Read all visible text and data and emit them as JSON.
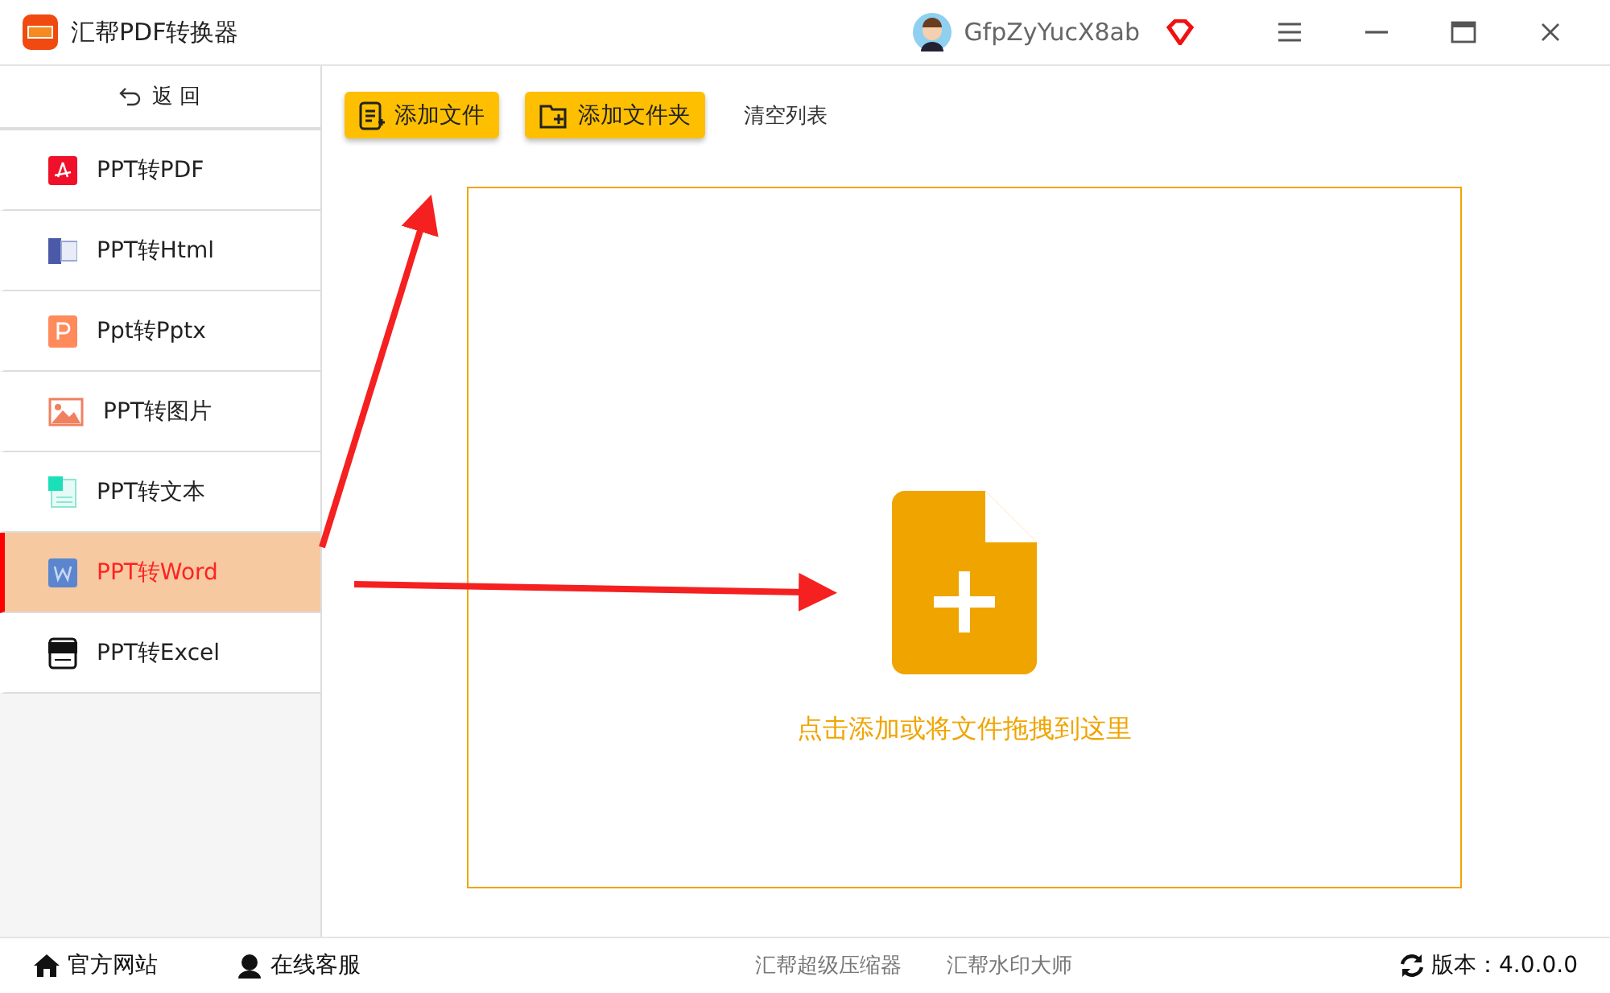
{
  "window": {
    "title": "汇帮PDF转换器",
    "user": "GfpZyYucX8ab"
  },
  "sidebar": {
    "back": "返 回",
    "items": [
      {
        "kind": "pdf",
        "label": "PPT转PDF",
        "selected": false
      },
      {
        "kind": "html",
        "label": "PPT转Html",
        "selected": false
      },
      {
        "kind": "pptx",
        "label": "Ppt转Pptx",
        "selected": false
      },
      {
        "kind": "image",
        "label": "PPT转图片",
        "selected": false
      },
      {
        "kind": "text",
        "label": "PPT转文本",
        "selected": false
      },
      {
        "kind": "word",
        "label": "PPT转Word",
        "selected": true
      },
      {
        "kind": "excel",
        "label": "PPT转Excel",
        "selected": false
      }
    ]
  },
  "toolbar": {
    "add_file": "添加文件",
    "add_folder": "添加文件夹",
    "clear": "清空列表"
  },
  "dropzone": {
    "hint": "点击添加或将文件拖拽到这里"
  },
  "status_bar": {
    "website": "官方网站",
    "service": "在线客服",
    "links": [
      "汇帮超级压缩器",
      "汇帮水印大师"
    ],
    "version": "版本：4.0.0.0"
  }
}
